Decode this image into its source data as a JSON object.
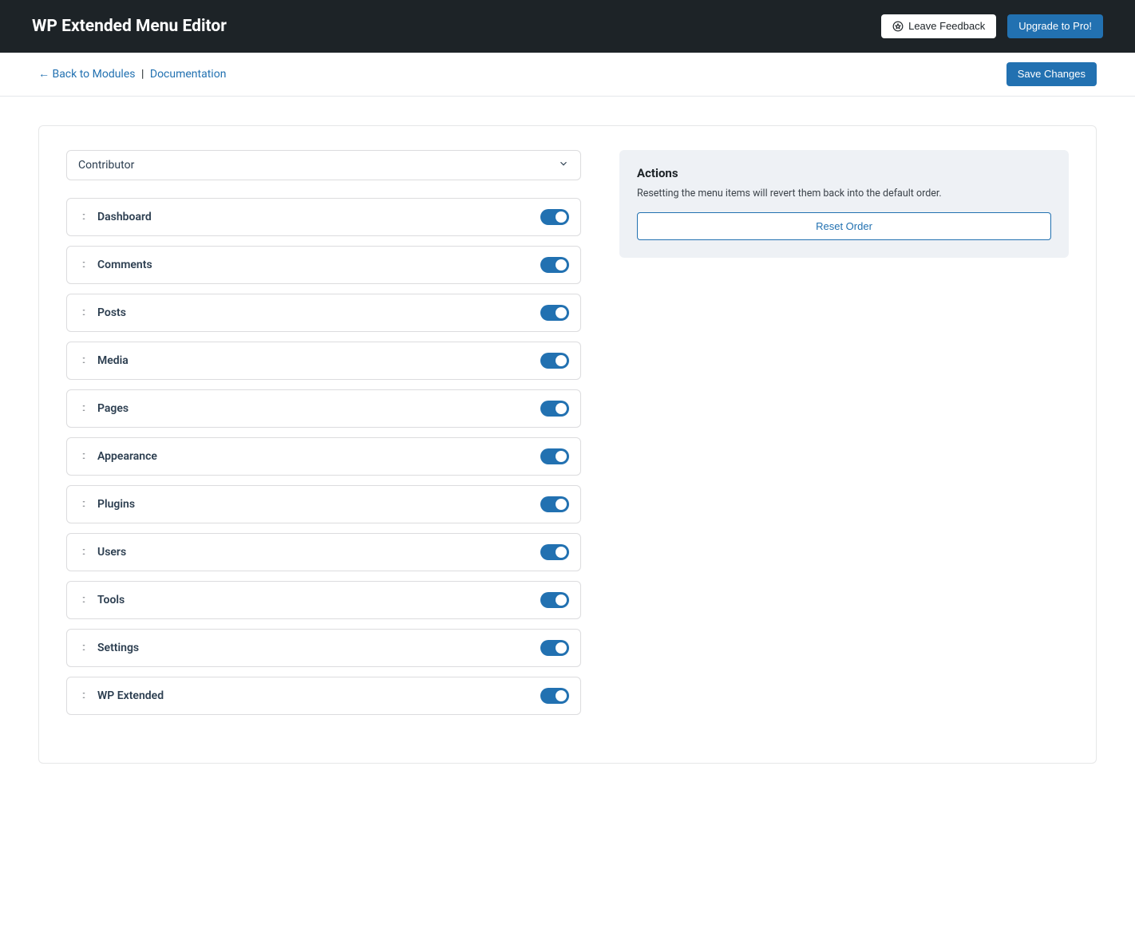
{
  "header": {
    "title": "WP Extended Menu Editor",
    "feedback_label": "Leave Feedback",
    "upgrade_label": "Upgrade to Pro!"
  },
  "subbar": {
    "back_label": "← Back to Modules",
    "separator": "|",
    "doc_label": "Documentation",
    "save_label": "Save Changes"
  },
  "role_select": {
    "selected": "Contributor"
  },
  "menu_items": [
    {
      "label": "Dashboard",
      "enabled": true
    },
    {
      "label": "Comments",
      "enabled": true
    },
    {
      "label": "Posts",
      "enabled": true
    },
    {
      "label": "Media",
      "enabled": true
    },
    {
      "label": "Pages",
      "enabled": true
    },
    {
      "label": "Appearance",
      "enabled": true
    },
    {
      "label": "Plugins",
      "enabled": true
    },
    {
      "label": "Users",
      "enabled": true
    },
    {
      "label": "Tools",
      "enabled": true
    },
    {
      "label": "Settings",
      "enabled": true
    },
    {
      "label": "WP Extended",
      "enabled": true
    }
  ],
  "actions_panel": {
    "title": "Actions",
    "description": "Resetting the menu items will revert them back into the default order.",
    "reset_label": "Reset Order"
  }
}
